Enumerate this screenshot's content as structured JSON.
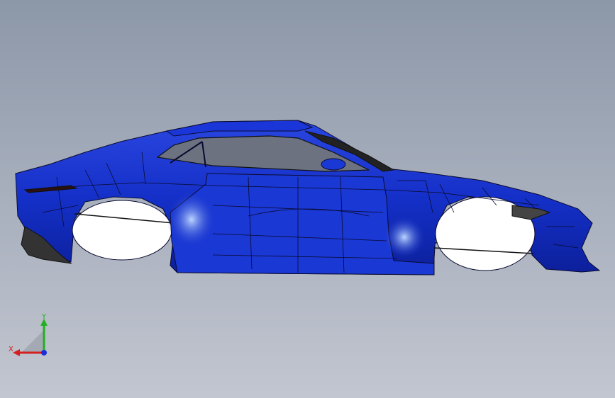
{
  "scene": {
    "description_tag": "cad-car-body-side-view",
    "body_color": "#1530c8",
    "background_top": "#8c97a8",
    "background_bottom": "#c2c6d0"
  },
  "triad": {
    "x_label": "X",
    "y_label": "Y",
    "x_color": "#d42020",
    "y_color": "#20b020",
    "z_color": "#1a2fd8"
  }
}
